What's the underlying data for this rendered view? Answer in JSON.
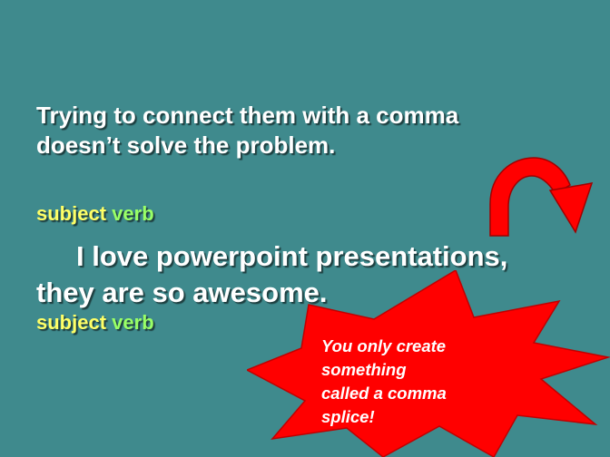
{
  "slide": {
    "heading_lines": [
      "Trying to connect them with a comma",
      "doesn’t solve the problem."
    ],
    "label_row_top": {
      "subject": "subject",
      "verb": "verb"
    },
    "sentence_lines": [
      "I love powerpoint presentations,",
      "they are so awesome."
    ],
    "label_row_bottom": {
      "subject": "subject",
      "verb": "verb"
    },
    "callout_lines": [
      "You only create",
      "something",
      "called a comma",
      "splice!"
    ]
  },
  "colors": {
    "background": "#3f8a8d",
    "subject_label": "#ffff66",
    "verb_label": "#99ff66",
    "burst_fill": "#ff0000",
    "arrow_fill": "#ff0000"
  },
  "icons": {
    "arrow": "curved-arrow-icon",
    "callout": "explosion-burst-shape"
  }
}
